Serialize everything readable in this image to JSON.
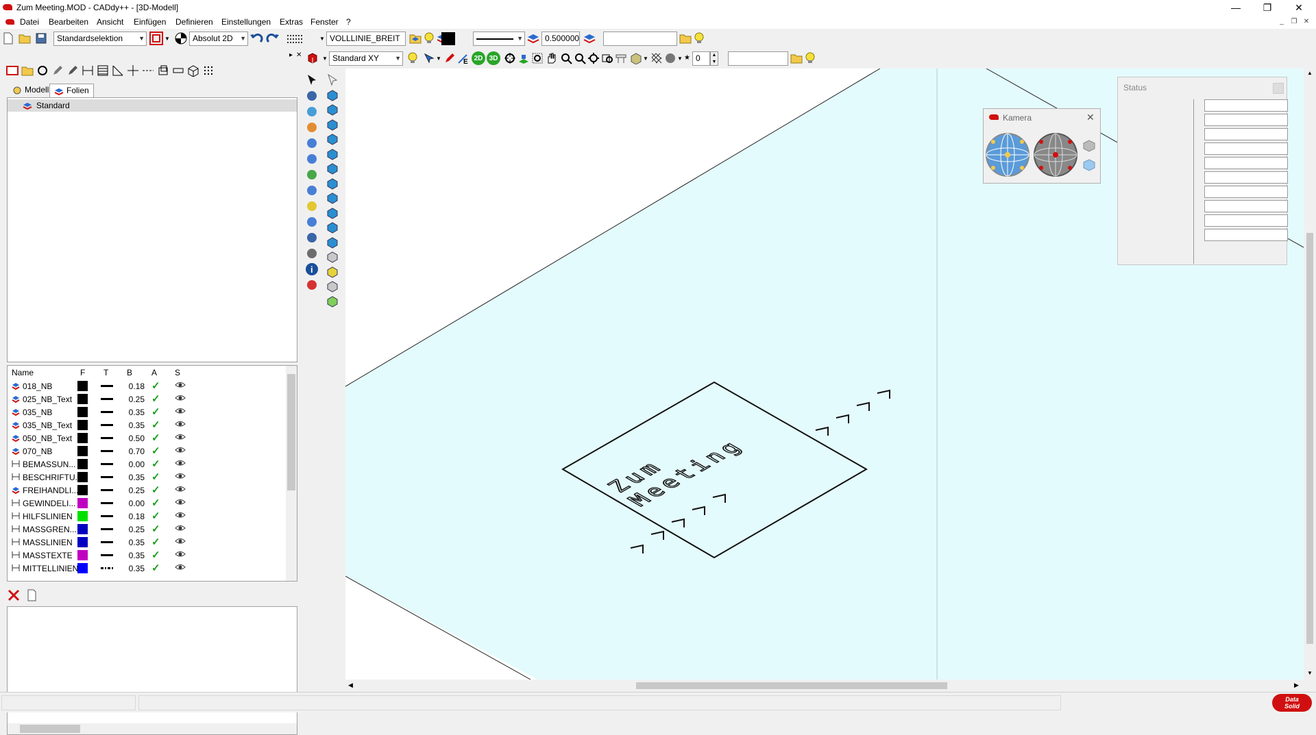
{
  "window": {
    "title": "Zum Meeting.MOD  -  CADdy++ - [3D-Modell]",
    "minimize_glyph": "—",
    "restore_glyph": "❐",
    "close_glyph": "✕"
  },
  "menu": {
    "items": [
      "Datei",
      "Bearbeiten",
      "Ansicht",
      "Einfügen",
      "Definieren",
      "Einstellungen",
      "Extras",
      "Fenster",
      "?"
    ],
    "mdi_minimize": "_",
    "mdi_restore": "❐",
    "mdi_close": "✕"
  },
  "toolbar1": {
    "selection_mode": "Standardselektion",
    "coord_mode": "Absolut 2D",
    "linetype_name": "VOLLLINIE_BREIT",
    "line_width": "0.500000",
    "extra_field": ""
  },
  "toolbar2": {
    "view_plane": "Standard XY",
    "btn_2d": "2D",
    "btn_3d": "3D",
    "spin_value": "0",
    "extra_field": ""
  },
  "leftpanel": {
    "tabs": [
      "Modell",
      "Folien"
    ],
    "active_tab": "Folien",
    "tree_root": "Standard",
    "columns": [
      "Name",
      "F",
      "T",
      "B",
      "A",
      "S"
    ],
    "layers": [
      {
        "name": "018_NB",
        "color": "#000000",
        "width": "0.18"
      },
      {
        "name": "025_NB_Text",
        "color": "#000000",
        "width": "0.25"
      },
      {
        "name": "035_NB",
        "color": "#000000",
        "width": "0.35"
      },
      {
        "name": "035_NB_Text",
        "color": "#000000",
        "width": "0.35"
      },
      {
        "name": "050_NB_Text",
        "color": "#000000",
        "width": "0.50"
      },
      {
        "name": "070_NB",
        "color": "#000000",
        "width": "0.70"
      },
      {
        "name": "BEMASSUN...",
        "color": "#000000",
        "width": "0.00"
      },
      {
        "name": "BESCHRIFTU...",
        "color": "#000000",
        "width": "0.35"
      },
      {
        "name": "FREIHANDLI...",
        "color": "#000000",
        "width": "0.25"
      },
      {
        "name": "GEWINDELI...",
        "color": "#c000c0",
        "width": "0.00"
      },
      {
        "name": "HILFSLINIEN",
        "color": "#00e000",
        "width": "0.18"
      },
      {
        "name": "MASSGREN...",
        "color": "#0000c0",
        "width": "0.25"
      },
      {
        "name": "MASSLINIEN",
        "color": "#0000c0",
        "width": "0.35"
      },
      {
        "name": "MASSTEXTE",
        "color": "#c000c0",
        "width": "0.35"
      },
      {
        "name": "MITTELLINIEN",
        "color": "#0000ff",
        "width": "0.35"
      }
    ],
    "check_glyph": "✓"
  },
  "canvas": {
    "plate_color": "#e4fbfd",
    "text_line1": "Zum",
    "text_line2": "Meeting"
  },
  "status_panel": {
    "title": "Status"
  },
  "camera_panel": {
    "title": "Kamera",
    "close_glyph": "✕"
  },
  "statusbar": {
    "logo_top": "Data",
    "logo_bottom": "Solid"
  }
}
